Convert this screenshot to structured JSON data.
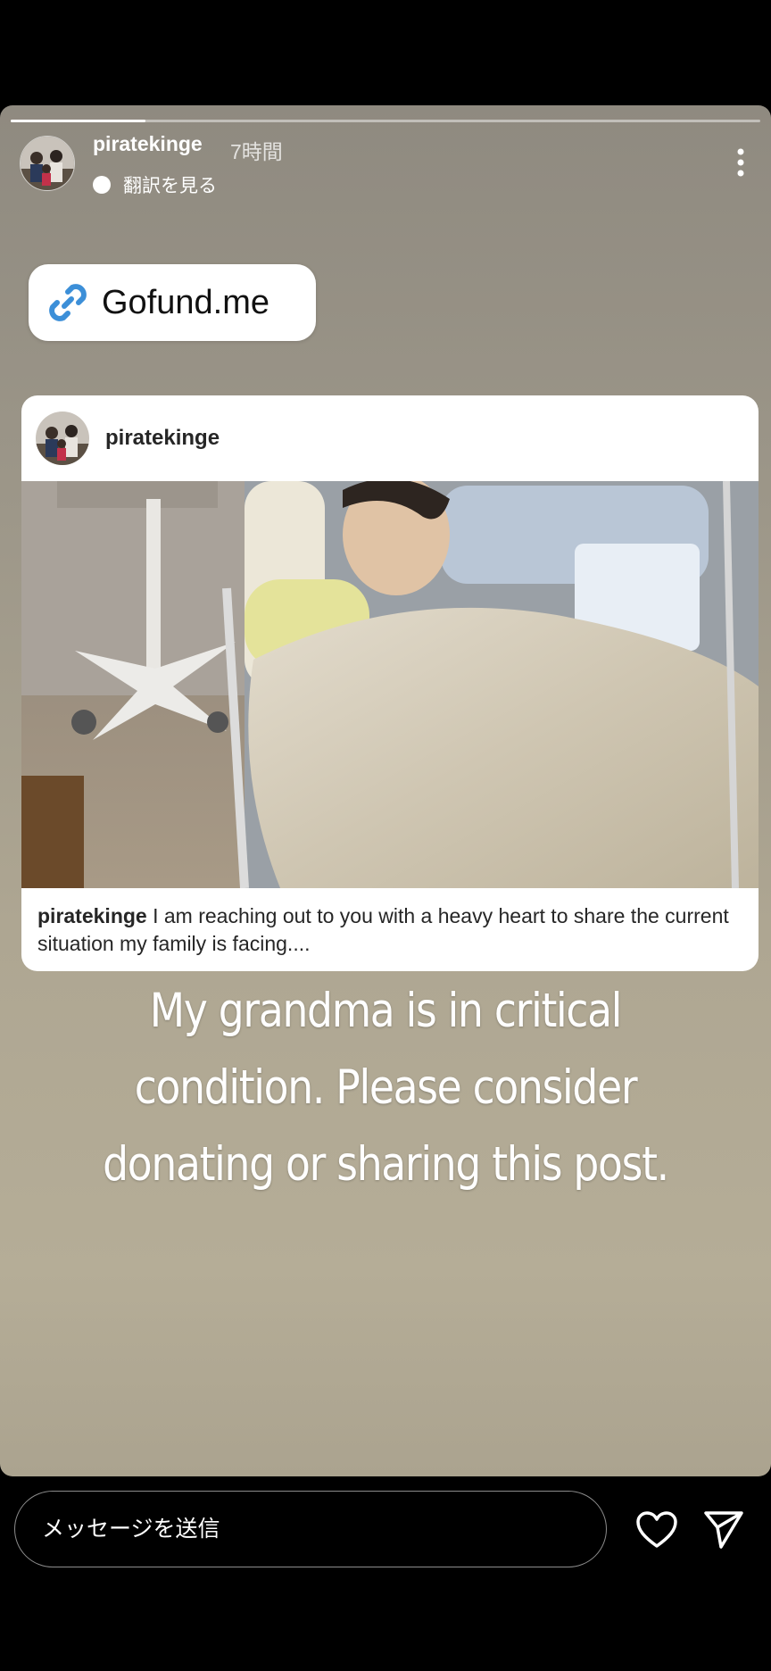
{
  "story": {
    "progress": 0.18,
    "username": "piratekinge",
    "time_ago": "7時間",
    "translate_label": "翻訳を見る",
    "more_icon": "more-vertical-icon"
  },
  "link_sticker": {
    "icon": "link-icon",
    "label": "Gofund.me",
    "icon_color": "#3c8fd8"
  },
  "shared_post": {
    "username": "piratekinge",
    "photo_icon": "hospital-bed-photo",
    "caption_user": "piratekinge",
    "caption_text": " I am reaching out to you with a heavy heart to share the current situation my family is facing...."
  },
  "overlay_text": "My grandma is in critical condition. Please consider donating or sharing this post.",
  "bottom_bar": {
    "message_placeholder": "メッセージを送信",
    "heart_icon": "heart-icon",
    "send_icon": "send-icon"
  }
}
